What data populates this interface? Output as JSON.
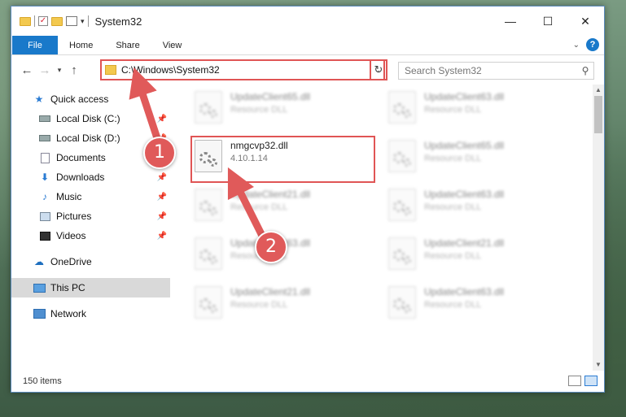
{
  "window": {
    "title": "System32",
    "controls": {
      "minimize": "—",
      "maximize": "☐",
      "close": "✕"
    }
  },
  "ribbon": {
    "tabs": [
      "File",
      "Home",
      "Share",
      "View"
    ],
    "help": "?"
  },
  "address": {
    "path": "C:\\Windows\\System32",
    "search_placeholder": "Search System32"
  },
  "sidebar": {
    "items": [
      {
        "label": "Quick access",
        "icon": "star-icon"
      },
      {
        "label": "Local Disk (C:)",
        "icon": "disk-icon",
        "pinned": true
      },
      {
        "label": "Local Disk (D:)",
        "icon": "disk-icon",
        "pinned": true
      },
      {
        "label": "Documents",
        "icon": "documents-icon",
        "pinned": true
      },
      {
        "label": "Downloads",
        "icon": "downloads-icon",
        "pinned": true
      },
      {
        "label": "Music",
        "icon": "music-icon",
        "pinned": true
      },
      {
        "label": "Pictures",
        "icon": "pictures-icon",
        "pinned": true
      },
      {
        "label": "Videos",
        "icon": "videos-icon",
        "pinned": true
      },
      {
        "label": "OneDrive",
        "icon": "cloud-icon"
      },
      {
        "label": "This PC",
        "icon": "pc-icon",
        "selected": true
      },
      {
        "label": "Network",
        "icon": "network-icon"
      }
    ]
  },
  "files": [
    {
      "name": "UpdateClient65.dll",
      "desc": "Resource DLL",
      "blurred": true
    },
    {
      "name": "UpdateClient63.dll",
      "desc": "Resource DLL",
      "blurred": true
    },
    {
      "name": "nmgcvp32.dll",
      "desc": "4.10.1.14",
      "blurred": false
    },
    {
      "name": "UpdateClient65.dll",
      "desc": "Resource DLL",
      "blurred": true
    },
    {
      "name": "UpdateClient21.dll",
      "desc": "Resource DLL",
      "blurred": true
    },
    {
      "name": "UpdateClient63.dll",
      "desc": "Resource DLL",
      "blurred": true
    },
    {
      "name": "UpdateClient63.dll",
      "desc": "Resource DLL",
      "blurred": true
    },
    {
      "name": "UpdateClient21.dll",
      "desc": "Resource DLL",
      "blurred": true
    },
    {
      "name": "UpdateClient21.dll",
      "desc": "Resource DLL",
      "blurred": true
    },
    {
      "name": "UpdateClient63.dll",
      "desc": "Resource DLL",
      "blurred": true
    }
  ],
  "status": {
    "item_count": "150 items"
  },
  "annotations": {
    "step1": "1",
    "step2": "2",
    "color": "#e05a5a"
  }
}
